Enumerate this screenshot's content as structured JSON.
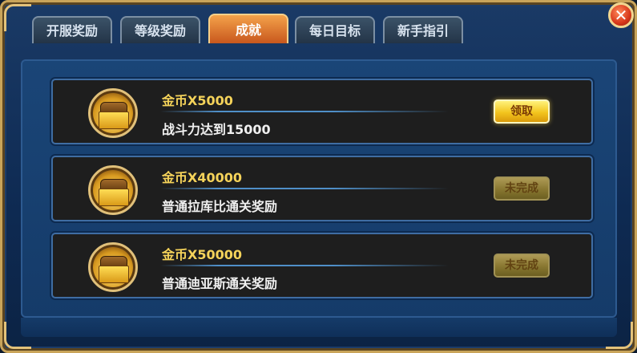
{
  "tabs": [
    {
      "label": "开服奖励"
    },
    {
      "label": "等级奖励"
    },
    {
      "label": "成就"
    },
    {
      "label": "每日目标"
    },
    {
      "label": "新手指引"
    }
  ],
  "active_tab_index": 2,
  "close_symbol": "✕",
  "achievements": [
    {
      "reward": "金币X5000",
      "description": "战斗力达到15000",
      "button_label": "领取",
      "button_state": "claimable"
    },
    {
      "reward": "金币X40000",
      "description": "普通拉库比通关奖励",
      "button_label": "未完成",
      "button_state": "incomplete"
    },
    {
      "reward": "金币X50000",
      "description": "普通迪亚斯通关奖励",
      "button_label": "未完成",
      "button_state": "incomplete"
    }
  ],
  "icons": {
    "reward": "treasure-chest-icon",
    "close": "close-icon"
  },
  "colors": {
    "reward_text": "#f5d35a",
    "active_tab": "#e07a2c",
    "claim_button": "#f3c51e"
  }
}
